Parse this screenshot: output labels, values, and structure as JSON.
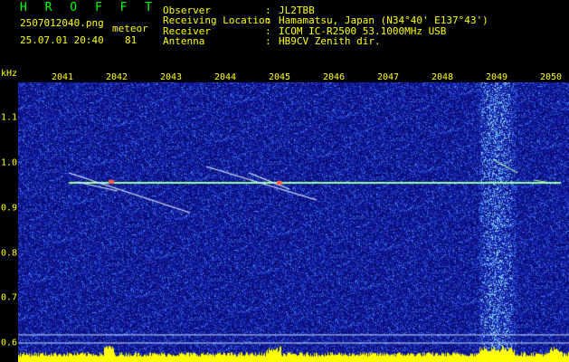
{
  "header": {
    "app_name": "H R O F F T",
    "filename": "2507012040.png",
    "datetime": "25.07.01 20:40",
    "mode_label": "meteor",
    "count": "81",
    "fields": [
      {
        "label": "Observer",
        "sep": ":",
        "value": "JL2TBB"
      },
      {
        "label": "Receiving Location",
        "sep": ":",
        "value": "Hamamatsu, Japan (N34°40' E137°43')"
      },
      {
        "label": "Receiver",
        "sep": ":",
        "value": "ICOM IC-R2500 53.1000MHz USB"
      },
      {
        "label": "Antenna",
        "sep": ":",
        "value": "HB9CV Zenith dir."
      }
    ]
  },
  "spectrogram": {
    "y_unit": "kHz",
    "x_ticks": [
      "2041",
      "2042",
      "2043",
      "2044",
      "2045",
      "2046",
      "2047",
      "2048",
      "2049",
      "2050"
    ],
    "y_ticks": [
      "1.1",
      "1.0",
      "0.9",
      "0.8",
      "0.7",
      "0.6"
    ],
    "colors": {
      "background": "#000000",
      "noise": "#1a22a8",
      "text": "#ffff00",
      "logo": "#00ff00",
      "carrier": "#9cff9c",
      "amplitude": "#ffff00"
    }
  }
}
